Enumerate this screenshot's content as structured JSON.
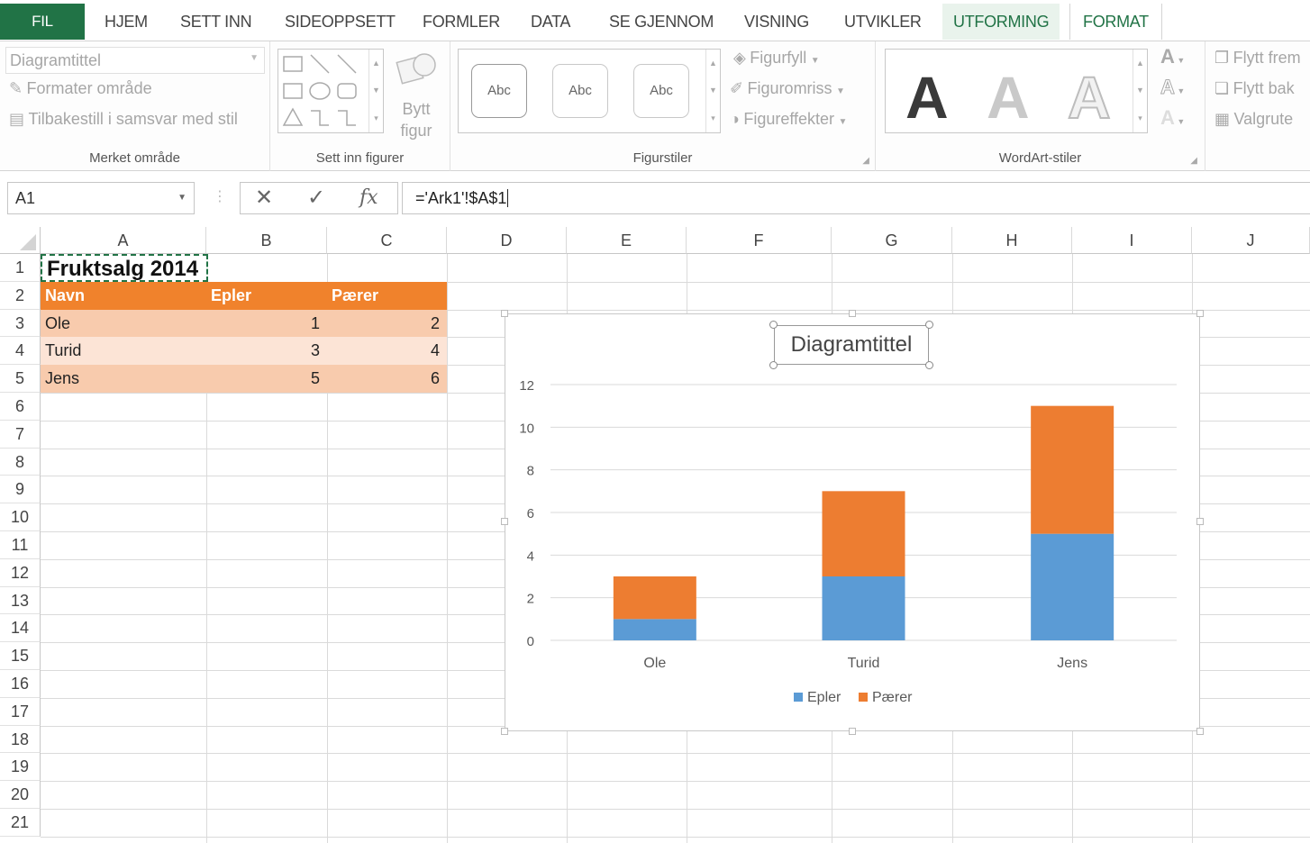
{
  "tabs": {
    "file": "FIL",
    "home": "HJEM",
    "insert": "SETT INN",
    "page_layout": "SIDEOPPSETT",
    "formulas": "FORMLER",
    "data": "DATA",
    "review": "SE GJENNOM",
    "view": "VISNING",
    "developer": "UTVIKLER",
    "design": "UTFORMING",
    "format": "FORMAT"
  },
  "ribbon": {
    "selection": {
      "dropdown_value": "Diagramtittel",
      "format_selection": "Formater område",
      "reset_to_match_style": "Tilbakestill i samsvar med stil",
      "label": "Merket område"
    },
    "insert_shapes": {
      "change_shape_line1": "Bytt",
      "change_shape_line2": "figur",
      "label": "Sett inn figurer"
    },
    "shape_styles": {
      "sample": "Abc",
      "shape_fill": "Figurfyll",
      "shape_outline": "Figuromriss",
      "shape_effects": "Figureffekter",
      "label": "Figurstiler"
    },
    "wordart": {
      "letter": "A",
      "label": "WordArt-stiler"
    },
    "arrange": {
      "bring_forward": "Flytt frem",
      "send_backward": "Flytt bak",
      "selection_pane": "Valgrute"
    }
  },
  "formula_bar": {
    "name_box": "A1",
    "fx": "fx",
    "formula": "='Ark1'!$A$1"
  },
  "grid": {
    "columns": [
      "A",
      "B",
      "C",
      "D",
      "E",
      "F",
      "G",
      "H",
      "I",
      "J"
    ],
    "rows": [
      "1",
      "2",
      "3",
      "4",
      "5",
      "6",
      "7",
      "8",
      "9",
      "10",
      "11",
      "12",
      "13",
      "14",
      "15",
      "16",
      "17",
      "18",
      "19",
      "20",
      "21"
    ],
    "title": "Fruktsalg 2014",
    "table_headers": [
      "Navn",
      "Epler",
      "Pærer"
    ],
    "table_rows": [
      [
        "Ole",
        "1",
        "2"
      ],
      [
        "Turid",
        "3",
        "4"
      ],
      [
        "Jens",
        "5",
        "6"
      ]
    ]
  },
  "chart_data": {
    "type": "bar",
    "stacked": true,
    "title": "Diagramtittel",
    "categories": [
      "Ole",
      "Turid",
      "Jens"
    ],
    "series": [
      {
        "name": "Epler",
        "values": [
          1,
          3,
          5
        ],
        "color": "#5b9bd5"
      },
      {
        "name": "Pærer",
        "values": [
          2,
          4,
          6
        ],
        "color": "#ed7d31"
      }
    ],
    "ylim": [
      0,
      12
    ],
    "yticks": [
      0,
      2,
      4,
      6,
      8,
      10,
      12
    ],
    "grid": true,
    "legend": "bottom"
  },
  "colors": {
    "brand": "#217346",
    "table_header": "#f0822c",
    "band_dark": "#f8cbad",
    "band_light": "#fce4d6"
  }
}
